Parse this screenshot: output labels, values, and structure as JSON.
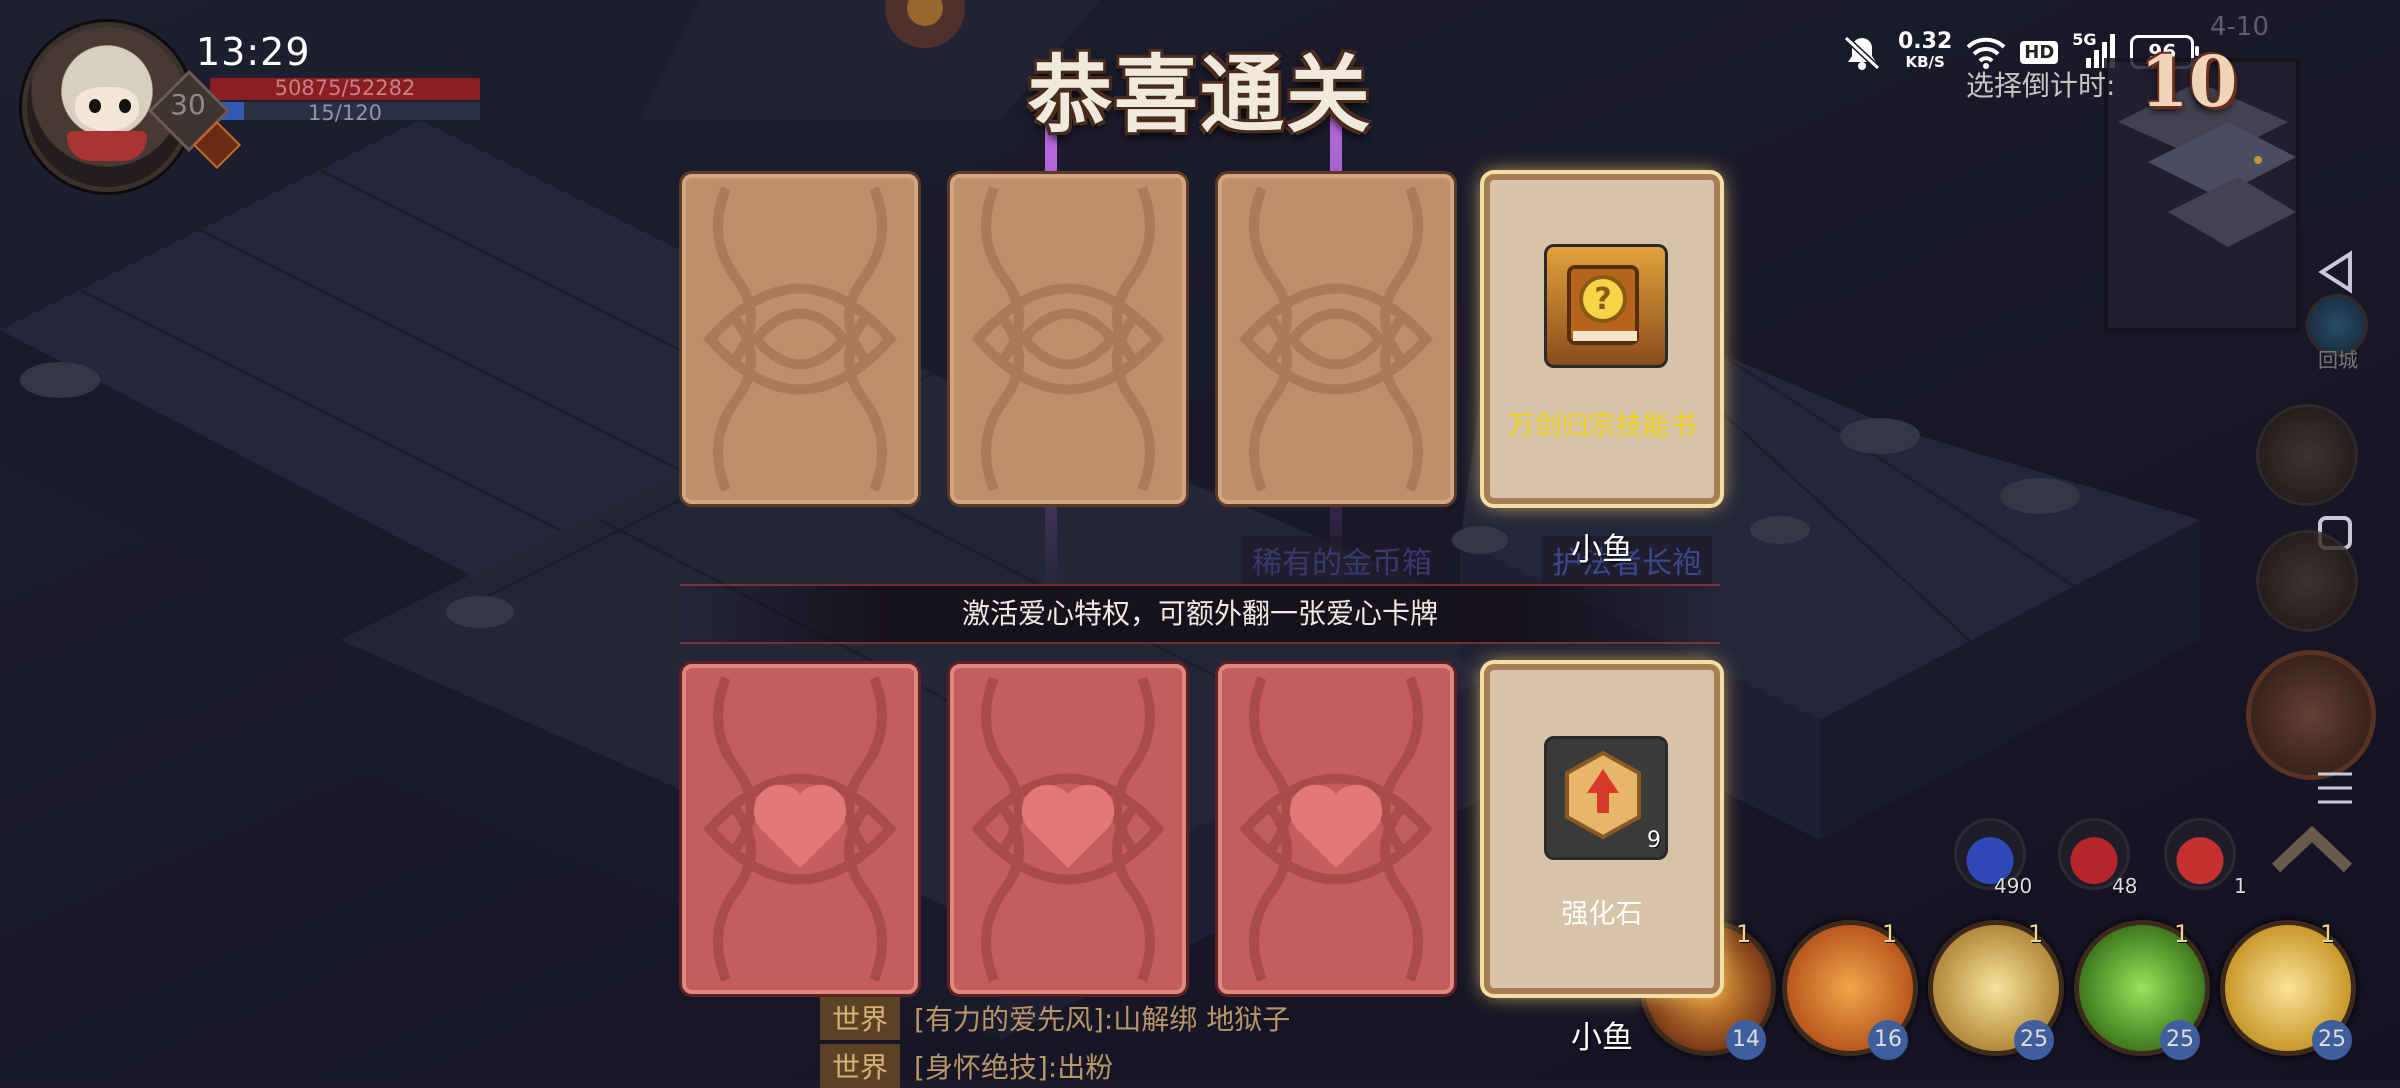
{
  "status_bar": {
    "time": "13:29",
    "net_speed": "0.32",
    "net_unit": "KB/S",
    "hd_label": "HD",
    "signal_label": "5G",
    "battery": "96"
  },
  "player": {
    "level": "30",
    "hp": "50875/52282",
    "mp": "15/120",
    "hp_fraction": 0.973,
    "mp_fraction": 0.125
  },
  "title": "恭喜通关",
  "stage_code": "4-10",
  "countdown": {
    "label": "选择倒计时:",
    "value": "10"
  },
  "nav": {
    "return_label": "回城"
  },
  "top_row": {
    "hidden_cards": 3,
    "reward": {
      "name": "万剑归宗技能书",
      "name_color": "#f2d41c",
      "icon": "skill-book-icon",
      "owner": "小鱼"
    }
  },
  "hint_text": "激活爱心特权，可额外翻一张爱心卡牌",
  "bottom_row": {
    "hidden_cards": 3,
    "reward": {
      "name": "强化石",
      "name_color": "#ffffff",
      "icon": "enhance-stone-icon",
      "count": "9",
      "owner": "小鱼"
    }
  },
  "map_labels": [
    "稀有的金币箱",
    "护法者长袍"
  ],
  "chat": [
    {
      "tag": "世界",
      "text": "[有力的爱先风]:山解绑 地狱子"
    },
    {
      "tag": "世界",
      "text": "[身怀绝技]:出粉"
    }
  ],
  "potions": [
    {
      "icon": "blue-potion-icon",
      "count": "490",
      "color": "#2f49b8"
    },
    {
      "icon": "red-potion-icon",
      "count": "48",
      "color": "#b3262a"
    },
    {
      "icon": "red-potion-small-icon",
      "count": "1",
      "color": "#c23030"
    }
  ],
  "skills": [
    {
      "icon": "skill-fire-icon",
      "level": "14",
      "charges": "1",
      "color": "#7a3a18"
    },
    {
      "icon": "skill-slash-icon",
      "level": "16",
      "charges": "1",
      "color": "#b8581e"
    },
    {
      "icon": "skill-burst-icon",
      "level": "25",
      "charges": "1",
      "color": "#b48a3c"
    },
    {
      "icon": "skill-poison-icon",
      "level": "25",
      "charges": "1",
      "color": "#3f7a1e"
    },
    {
      "icon": "skill-flash-icon",
      "level": "25",
      "charges": "1",
      "color": "#c99a2c"
    }
  ]
}
